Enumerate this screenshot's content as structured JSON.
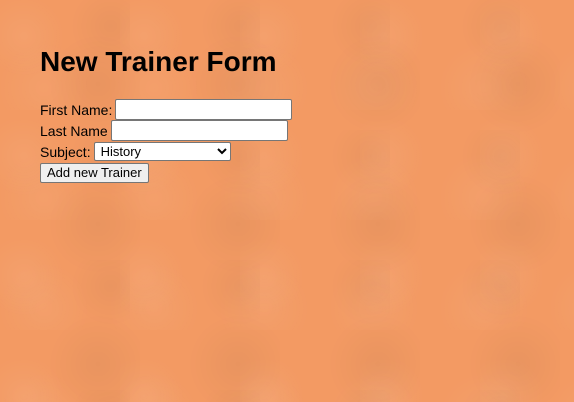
{
  "page": {
    "title": "New Trainer Form"
  },
  "form": {
    "first_name_label": "First Name:",
    "first_name_value": "",
    "last_name_label": "Last Name",
    "last_name_value": "",
    "subject_label": "Subject:",
    "subject_selected": "History",
    "submit_label": "Add new Trainer"
  },
  "colors": {
    "background": "#f39a63"
  }
}
